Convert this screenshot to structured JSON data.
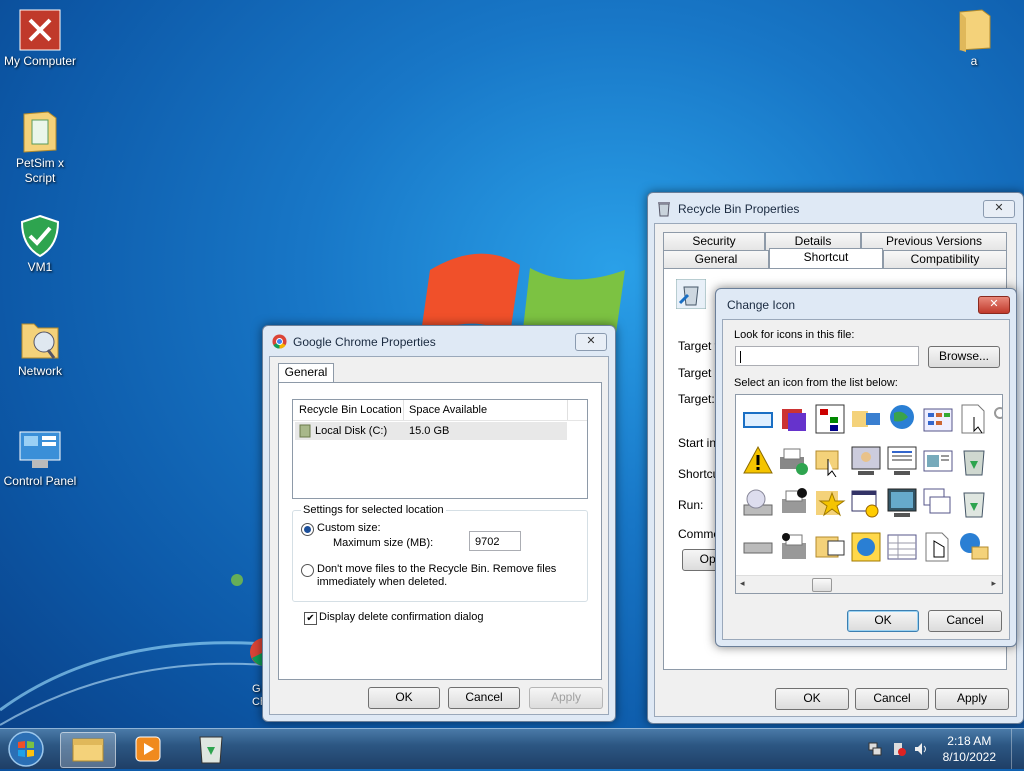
{
  "desktop": {
    "icons": [
      {
        "label": "My Computer",
        "icon": "my-computer-icon"
      },
      {
        "label": "PetSim x Script",
        "icon": "folder-icon"
      },
      {
        "label": "VM1",
        "icon": "shield-check-icon"
      },
      {
        "label": "Network",
        "icon": "network-folder-icon"
      },
      {
        "label": "Control Panel",
        "icon": "control-panel-icon"
      },
      {
        "label": "a",
        "icon": "folder-icon"
      }
    ],
    "partial_label": "G\nCh"
  },
  "chrome_props": {
    "title": "Google Chrome Properties",
    "tab_general": "General",
    "col_location": "Recycle Bin Location",
    "col_space": "Space Available",
    "row_location": "Local Disk (C:)",
    "row_space": "15.0 GB",
    "settings_group": "Settings for selected location",
    "custom_size": "Custom size:",
    "max_size_label": "Maximum size (MB):",
    "max_size_value": "9702",
    "dont_move_line1": "Don't move files to the Recycle Bin. Remove files",
    "dont_move_line2": "immediately when deleted.",
    "display_confirm": "Display delete confirmation dialog",
    "ok": "OK",
    "cancel": "Cancel",
    "apply": "Apply",
    "close": "✕"
  },
  "recycle_props": {
    "title": "Recycle Bin Properties",
    "tabs_row1": [
      "Security",
      "Details",
      "Previous Versions"
    ],
    "tabs_row2": [
      "General",
      "Shortcut",
      "Compatibility"
    ],
    "labels": [
      "Target ty",
      "Target lo",
      "Target:",
      "Start in:",
      "Shortcut",
      "Run:",
      "Commen"
    ],
    "open_btn": "Oper",
    "ok": "OK",
    "cancel": "Cancel",
    "apply": "Apply",
    "close": "✕"
  },
  "change_icon": {
    "title": "Change Icon",
    "look_for": "Look for icons in this file:",
    "file_value": "",
    "browse": "Browse...",
    "select_label": "Select an icon from the list below:",
    "ok": "OK",
    "cancel": "Cancel",
    "close": "✕"
  },
  "taskbar": {
    "time": "2:18 AM",
    "date": "8/10/2022"
  }
}
